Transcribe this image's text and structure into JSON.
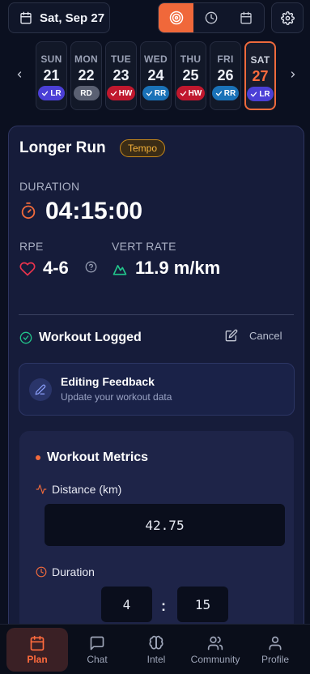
{
  "header": {
    "date_label": "Sat, Sep 27",
    "view_modes": [
      {
        "icon": "target-icon",
        "active": true
      },
      {
        "icon": "clock-icon",
        "active": false
      },
      {
        "icon": "calendar-icon",
        "active": false
      }
    ],
    "settings_icon": "gear-icon"
  },
  "week": {
    "days": [
      {
        "name": "SUN",
        "num": "21",
        "badge": "LR",
        "check": true,
        "color": "#4b3fd6"
      },
      {
        "name": "MON",
        "num": "22",
        "badge": "RD",
        "check": false,
        "color": "#5a6072"
      },
      {
        "name": "TUE",
        "num": "23",
        "badge": "HW",
        "check": true,
        "color": "#c0182e"
      },
      {
        "name": "WED",
        "num": "24",
        "badge": "RR",
        "check": true,
        "color": "#1a72b8"
      },
      {
        "name": "THU",
        "num": "25",
        "badge": "HW",
        "check": true,
        "color": "#c0182e"
      },
      {
        "name": "FRI",
        "num": "26",
        "badge": "RR",
        "check": true,
        "color": "#1a72b8"
      },
      {
        "name": "SAT",
        "num": "27",
        "badge": "LR",
        "check": true,
        "color": "#4b3fd6",
        "selected": true
      }
    ]
  },
  "workout": {
    "title": "Longer Run",
    "tag": "Tempo",
    "duration_label": "DURATION",
    "duration_value": "04:15:00",
    "rpe_label": "RPE",
    "rpe_value": "4-6",
    "vert_label": "VERT RATE",
    "vert_value": "11.9 m/km",
    "status": "Workout Logged",
    "cancel_label": "Cancel",
    "edit_title": "Editing Feedback",
    "edit_subtitle": "Update your workout data"
  },
  "metrics": {
    "title": "Workout Metrics",
    "distance_label": "Distance (km)",
    "distance_value": "42.75",
    "duration_label": "Duration",
    "duration_hours": "4",
    "duration_separator": ":",
    "duration_minutes": "15"
  },
  "nav": {
    "items": [
      {
        "label": "Plan",
        "icon": "calendar-icon",
        "active": true
      },
      {
        "label": "Chat",
        "icon": "chat-icon",
        "active": false
      },
      {
        "label": "Intel",
        "icon": "brain-icon",
        "active": false
      },
      {
        "label": "Community",
        "icon": "users-icon",
        "active": false
      },
      {
        "label": "Profile",
        "icon": "user-icon",
        "active": false
      }
    ]
  },
  "colors": {
    "accent": "#f0683a",
    "background": "#0b1020",
    "card": "#161c3a",
    "tag": "#f5b23a",
    "success": "#22c58b"
  }
}
